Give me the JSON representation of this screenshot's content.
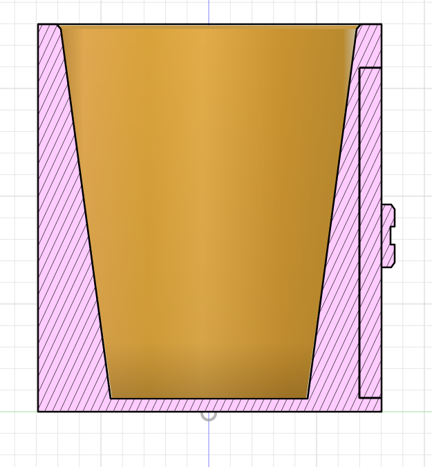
{
  "viewport": {
    "view": "section-analysis",
    "colors": {
      "background": "#ffffff",
      "grid_minor": "#e6e6e6",
      "grid_major": "#d2d2d2",
      "axis_vertical": "#8080ff",
      "axis_horizontal": "#9ddf9d",
      "section_fill": "#ffccff",
      "section_hatch": "#000000",
      "body_fill": "#d9a23a",
      "outline": "#000000"
    }
  }
}
